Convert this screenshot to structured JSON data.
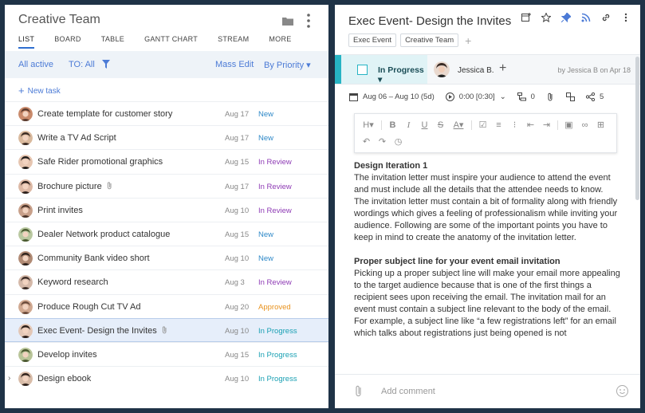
{
  "left": {
    "title": "Creative Team",
    "tabs": [
      "LIST",
      "BOARD",
      "TABLE",
      "GANTT CHART",
      "STREAM",
      "MORE"
    ],
    "filters": {
      "all_active": "All active",
      "to_all": "TO: All",
      "mass_edit": "Mass Edit",
      "by_priority": "By Priority ▾"
    },
    "new_task": "New task",
    "tasks": [
      {
        "name": "Create template for customer story",
        "date": "Aug 17",
        "status": "New",
        "color": "#2f89c8",
        "clip": false,
        "chev": false
      },
      {
        "name": "Write a TV Ad Script",
        "date": "Aug 17",
        "status": "New",
        "color": "#2f89c8",
        "clip": false,
        "chev": false
      },
      {
        "name": "Safe Rider promotional graphics",
        "date": "Aug 15",
        "status": "In Review",
        "color": "#8e3bb5",
        "clip": false,
        "chev": false
      },
      {
        "name": "Brochure picture",
        "date": "Aug 17",
        "status": "In Review",
        "color": "#8e3bb5",
        "clip": true,
        "chev": false
      },
      {
        "name": "Print invites",
        "date": "Aug 10",
        "status": "In Review",
        "color": "#8e3bb5",
        "clip": false,
        "chev": false
      },
      {
        "name": "Dealer Network product catalogue",
        "date": "Aug 15",
        "status": "New",
        "color": "#2f89c8",
        "clip": false,
        "chev": false
      },
      {
        "name": "Community Bank video short",
        "date": "Aug 10",
        "status": "New",
        "color": "#2f89c8",
        "clip": false,
        "chev": false
      },
      {
        "name": "Keyword research",
        "date": "Aug 3",
        "status": "In Review",
        "color": "#8e3bb5",
        "clip": false,
        "chev": false
      },
      {
        "name": "Produce Rough Cut TV Ad",
        "date": "Aug 20",
        "status": "Approved",
        "color": "#e8921e",
        "clip": false,
        "chev": false
      },
      {
        "name": "Exec Event- Design the Invites",
        "date": "Aug 10",
        "status": "In Progress",
        "color": "#1aa0b3",
        "clip": true,
        "chev": false,
        "selected": true
      },
      {
        "name": "Develop invites",
        "date": "Aug 15",
        "status": "In Progress",
        "color": "#1aa0b3",
        "clip": false,
        "chev": false
      },
      {
        "name": "Design ebook",
        "date": "Aug 10",
        "status": "In Progress",
        "color": "#1aa0b3",
        "clip": false,
        "chev": true
      }
    ]
  },
  "right": {
    "title": "Exec Event- Design the Invites",
    "tags": [
      "Exec Event",
      "Creative Team"
    ],
    "status": "In Progress",
    "assignee": "Jessica B.",
    "created_by": "by Jessica B on Apr 18",
    "meta": {
      "dates": "Aug 06 – Aug 10 (5d)",
      "timer": "0:00 [0:30]",
      "subtasks": "0",
      "shares": "5"
    },
    "doc": [
      {
        "type": "h",
        "text": "Design Iteration 1"
      },
      {
        "type": "p",
        "text": "The invitation letter must inspire your audience to attend the event and must include all the details that the attendee needs to know."
      },
      {
        "type": "p",
        "text": "The invitation letter must contain a bit of formality along with friendly wordings which gives a feeling of professionalism while inviting your audience. Following are some of the important points you have to keep in mind to create the anatomy of the invitation letter."
      },
      {
        "type": "spacer"
      },
      {
        "type": "h",
        "text": "Proper subject line for your event email invitation"
      },
      {
        "type": "p",
        "text": "Picking up a proper subject line will make your email more appealing to the target audience because that is one of the first things a recipient sees upon receiving the email. The invitation mail for an event must contain a subject line relevant to the body of the email."
      },
      {
        "type": "p",
        "text": "For example, a subject line like “a few registrations left” for an email which talks about registrations just being opened is not"
      }
    ],
    "comment_placeholder": "Add comment"
  }
}
